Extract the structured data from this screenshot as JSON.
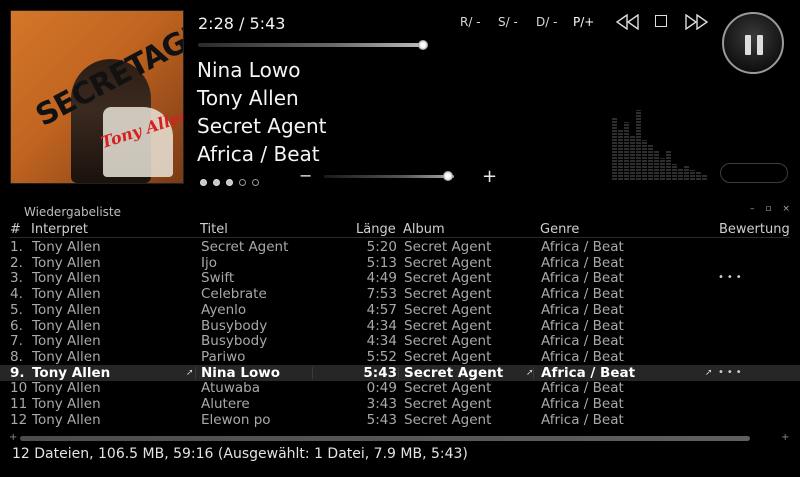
{
  "cover": {
    "top_text": "",
    "title": "SECRETAGENT",
    "artist": "Tony Allen",
    "small_text": ""
  },
  "player": {
    "time": "2:28 / 5:43",
    "progress": 0.431,
    "title": "Nina Lowo",
    "artist": "Tony Allen",
    "album": "Secret Agent",
    "genre": "Africa / Beat",
    "rating": 3,
    "rating_max": 5,
    "volume": 0.95,
    "vol_minus": "−",
    "vol_plus": "+"
  },
  "modes": [
    {
      "label": "R/ -"
    },
    {
      "label": "S/ -"
    },
    {
      "label": "D/ -"
    },
    {
      "label": "P/+"
    }
  ],
  "playlist": {
    "title": "Wiedergabeliste",
    "window_controls": "– ▫ ×",
    "columns": {
      "num": "#",
      "artist": "Interpret",
      "title": "Titel",
      "length": "Länge",
      "album": "Album",
      "genre": "Genre",
      "rating": "Bewertung"
    },
    "rows": [
      {
        "num": "1.",
        "artist": "Tony Allen",
        "title": "Secret Agent",
        "length": "5:20",
        "album": "Secret Agent",
        "genre": "Africa / Beat",
        "rating": ""
      },
      {
        "num": "2.",
        "artist": "Tony Allen",
        "title": "Ijo",
        "length": "5:13",
        "album": "Secret Agent",
        "genre": "Africa / Beat",
        "rating": ""
      },
      {
        "num": "3.",
        "artist": "Tony Allen",
        "title": "Swift",
        "length": "4:49",
        "album": "Secret Agent",
        "genre": "Africa / Beat",
        "rating": "•••"
      },
      {
        "num": "4.",
        "artist": "Tony Allen",
        "title": "Celebrate",
        "length": "7:53",
        "album": "Secret Agent",
        "genre": "Africa / Beat",
        "rating": ""
      },
      {
        "num": "5.",
        "artist": "Tony Allen",
        "title": "Ayenlo",
        "length": "4:57",
        "album": "Secret Agent",
        "genre": "Africa / Beat",
        "rating": ""
      },
      {
        "num": "6.",
        "artist": "Tony Allen",
        "title": "Busybody",
        "length": "4:34",
        "album": "Secret Agent",
        "genre": "Africa / Beat",
        "rating": ""
      },
      {
        "num": "7.",
        "artist": "Tony Allen",
        "title": "Busybody",
        "length": "4:34",
        "album": "Secret Agent",
        "genre": "Africa / Beat",
        "rating": ""
      },
      {
        "num": "8.",
        "artist": "Tony Allen",
        "title": "Pariwo",
        "length": "5:52",
        "album": "Secret Agent",
        "genre": "Africa / Beat",
        "rating": ""
      },
      {
        "num": "9.",
        "artist": "Tony Allen",
        "title": "Nina Lowo",
        "length": "5:43",
        "album": "Secret Agent",
        "genre": "Africa / Beat",
        "rating": "•••",
        "selected": true
      },
      {
        "num": "10",
        "artist": "Tony Allen",
        "title": "Atuwaba",
        "length": "0:49",
        "album": "Secret Agent",
        "genre": "Africa / Beat",
        "rating": ""
      },
      {
        "num": "11",
        "artist": "Tony Allen",
        "title": "Alutere",
        "length": "3:43",
        "album": "Secret Agent",
        "genre": "Africa / Beat",
        "rating": ""
      },
      {
        "num": "12",
        "artist": "Tony Allen",
        "title": "Elewon po",
        "length": "5:43",
        "album": "Secret Agent",
        "genre": "Africa / Beat",
        "rating": ""
      }
    ]
  },
  "status": "12 Dateien, 106.5 MB, 59:16 (Ausgewählt: 1 Datei, 7.9 MB, 5:43)",
  "icons": {
    "prev": "rewind-icon",
    "stop": "stop-icon",
    "next": "fast-forward-icon",
    "pause": "pause-icon"
  }
}
